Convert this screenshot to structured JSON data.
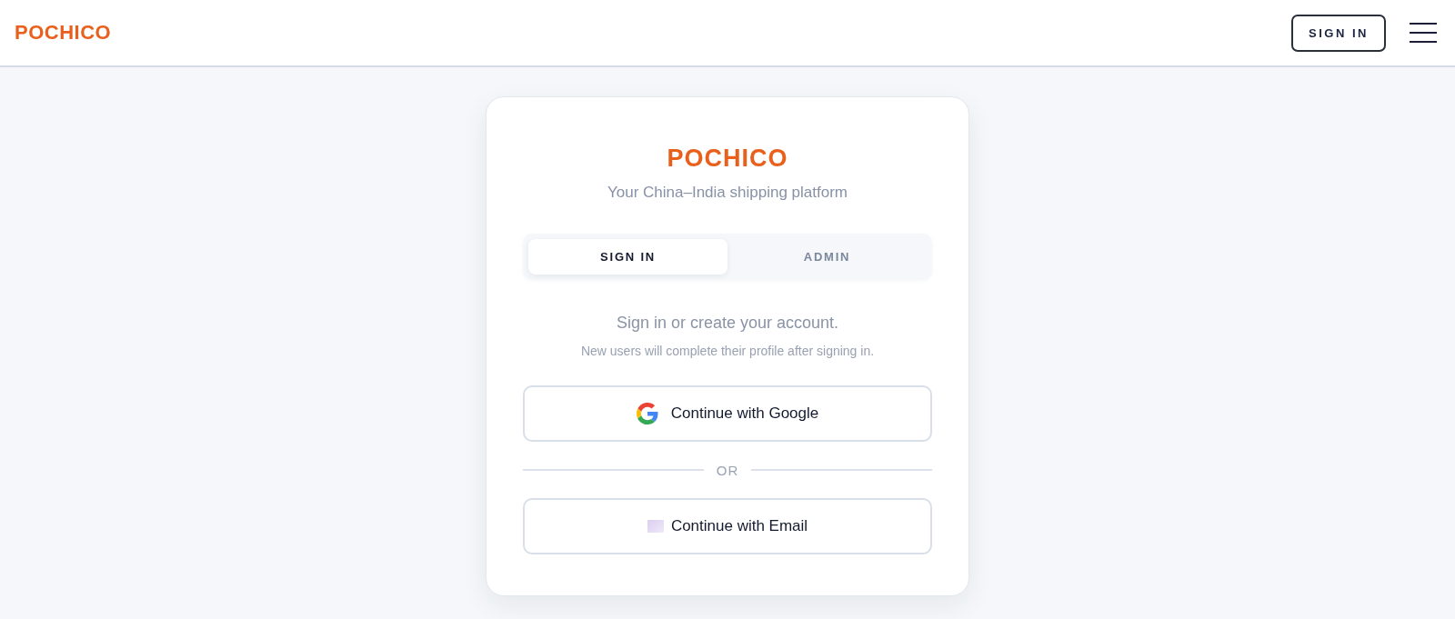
{
  "header": {
    "logo": "POCHICO",
    "sign_in_button": "SIGN IN"
  },
  "card": {
    "logo": "POCHICO",
    "tagline": "Your China–India shipping platform",
    "tabs": [
      {
        "label": "SIGN IN",
        "selected": true
      },
      {
        "label": "ADMIN",
        "selected": false
      }
    ],
    "heading": "Sign in or create your account.",
    "note": "New users will complete their profile after signing in.",
    "providers": [
      {
        "kind": "google",
        "label": "Continue with Google"
      },
      {
        "kind": "email",
        "label": "Continue with Email"
      }
    ],
    "divider": "OR"
  }
}
